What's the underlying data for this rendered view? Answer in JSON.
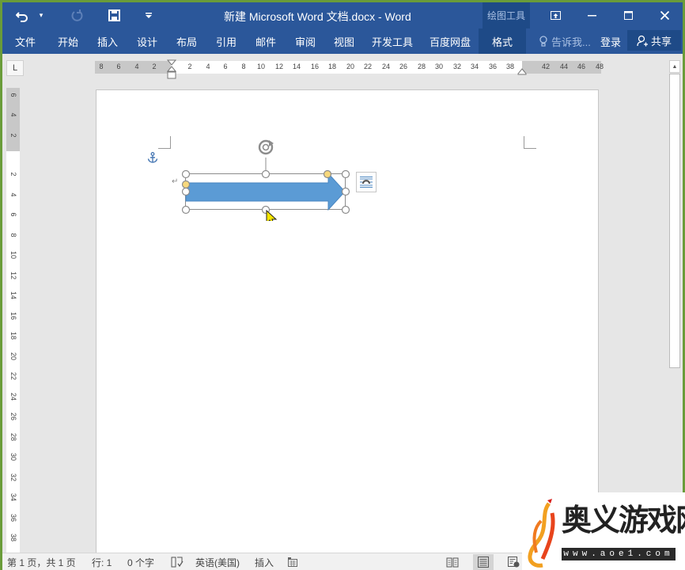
{
  "window": {
    "title": "新建 Microsoft Word 文档.docx - Word",
    "context_group": "绘图工具",
    "controls": {
      "ribbon_display": "ribbon-display-icon",
      "minimize": "minimize-icon",
      "maximize": "maximize-icon",
      "close": "close-icon"
    }
  },
  "quick_access": {
    "undo": "undo-icon",
    "redo": "redo-icon",
    "save": "save-icon",
    "customize": "customize-icon"
  },
  "ribbon": {
    "tabs": [
      {
        "label": "文件"
      },
      {
        "label": "开始"
      },
      {
        "label": "插入"
      },
      {
        "label": "设计"
      },
      {
        "label": "布局"
      },
      {
        "label": "引用"
      },
      {
        "label": "邮件"
      },
      {
        "label": "审阅"
      },
      {
        "label": "视图"
      },
      {
        "label": "开发工具"
      },
      {
        "label": "百度网盘"
      },
      {
        "label": "格式"
      }
    ],
    "active_tab": "格式",
    "tell_me": "告诉我...",
    "login": "登录",
    "share": "共享"
  },
  "ruler": {
    "tab_selector": "L",
    "horizontal_ticks": [
      "8",
      "6",
      "4",
      "2",
      "2",
      "4",
      "6",
      "8",
      "10",
      "12",
      "14",
      "16",
      "18",
      "20",
      "22",
      "24",
      "26",
      "28",
      "30",
      "32",
      "34",
      "36",
      "38",
      "42",
      "44",
      "46",
      "48"
    ],
    "vertical_ticks": [
      "6",
      "4",
      "2",
      "2",
      "4",
      "6",
      "8",
      "10",
      "12",
      "14",
      "16",
      "18",
      "20",
      "22",
      "24",
      "26",
      "28",
      "30",
      "32",
      "34",
      "36",
      "38"
    ]
  },
  "document": {
    "shape": {
      "type": "right-arrow",
      "fill": "#5b9bd5",
      "selected": true
    },
    "layout_options_icon": "layout-options-icon",
    "anchor_icon": "anchor-icon",
    "paragraph_mark": "↵"
  },
  "statusbar": {
    "page": "第 1 页，共 1 页",
    "line": "行: 1",
    "words": "0 个字",
    "language": "英语(美国)",
    "mode": "插入",
    "views": [
      "read-mode-icon",
      "print-layout-icon",
      "web-layout-icon"
    ],
    "active_view": "print-layout-icon"
  },
  "watermark": {
    "text": "奥义游戏网",
    "url": "www.aoe1.com"
  },
  "colors": {
    "brand": "#2b579a",
    "brand_dark": "#1e4a87",
    "shape_fill": "#5b9bd5",
    "handle_yellow": "#f7d87c"
  }
}
